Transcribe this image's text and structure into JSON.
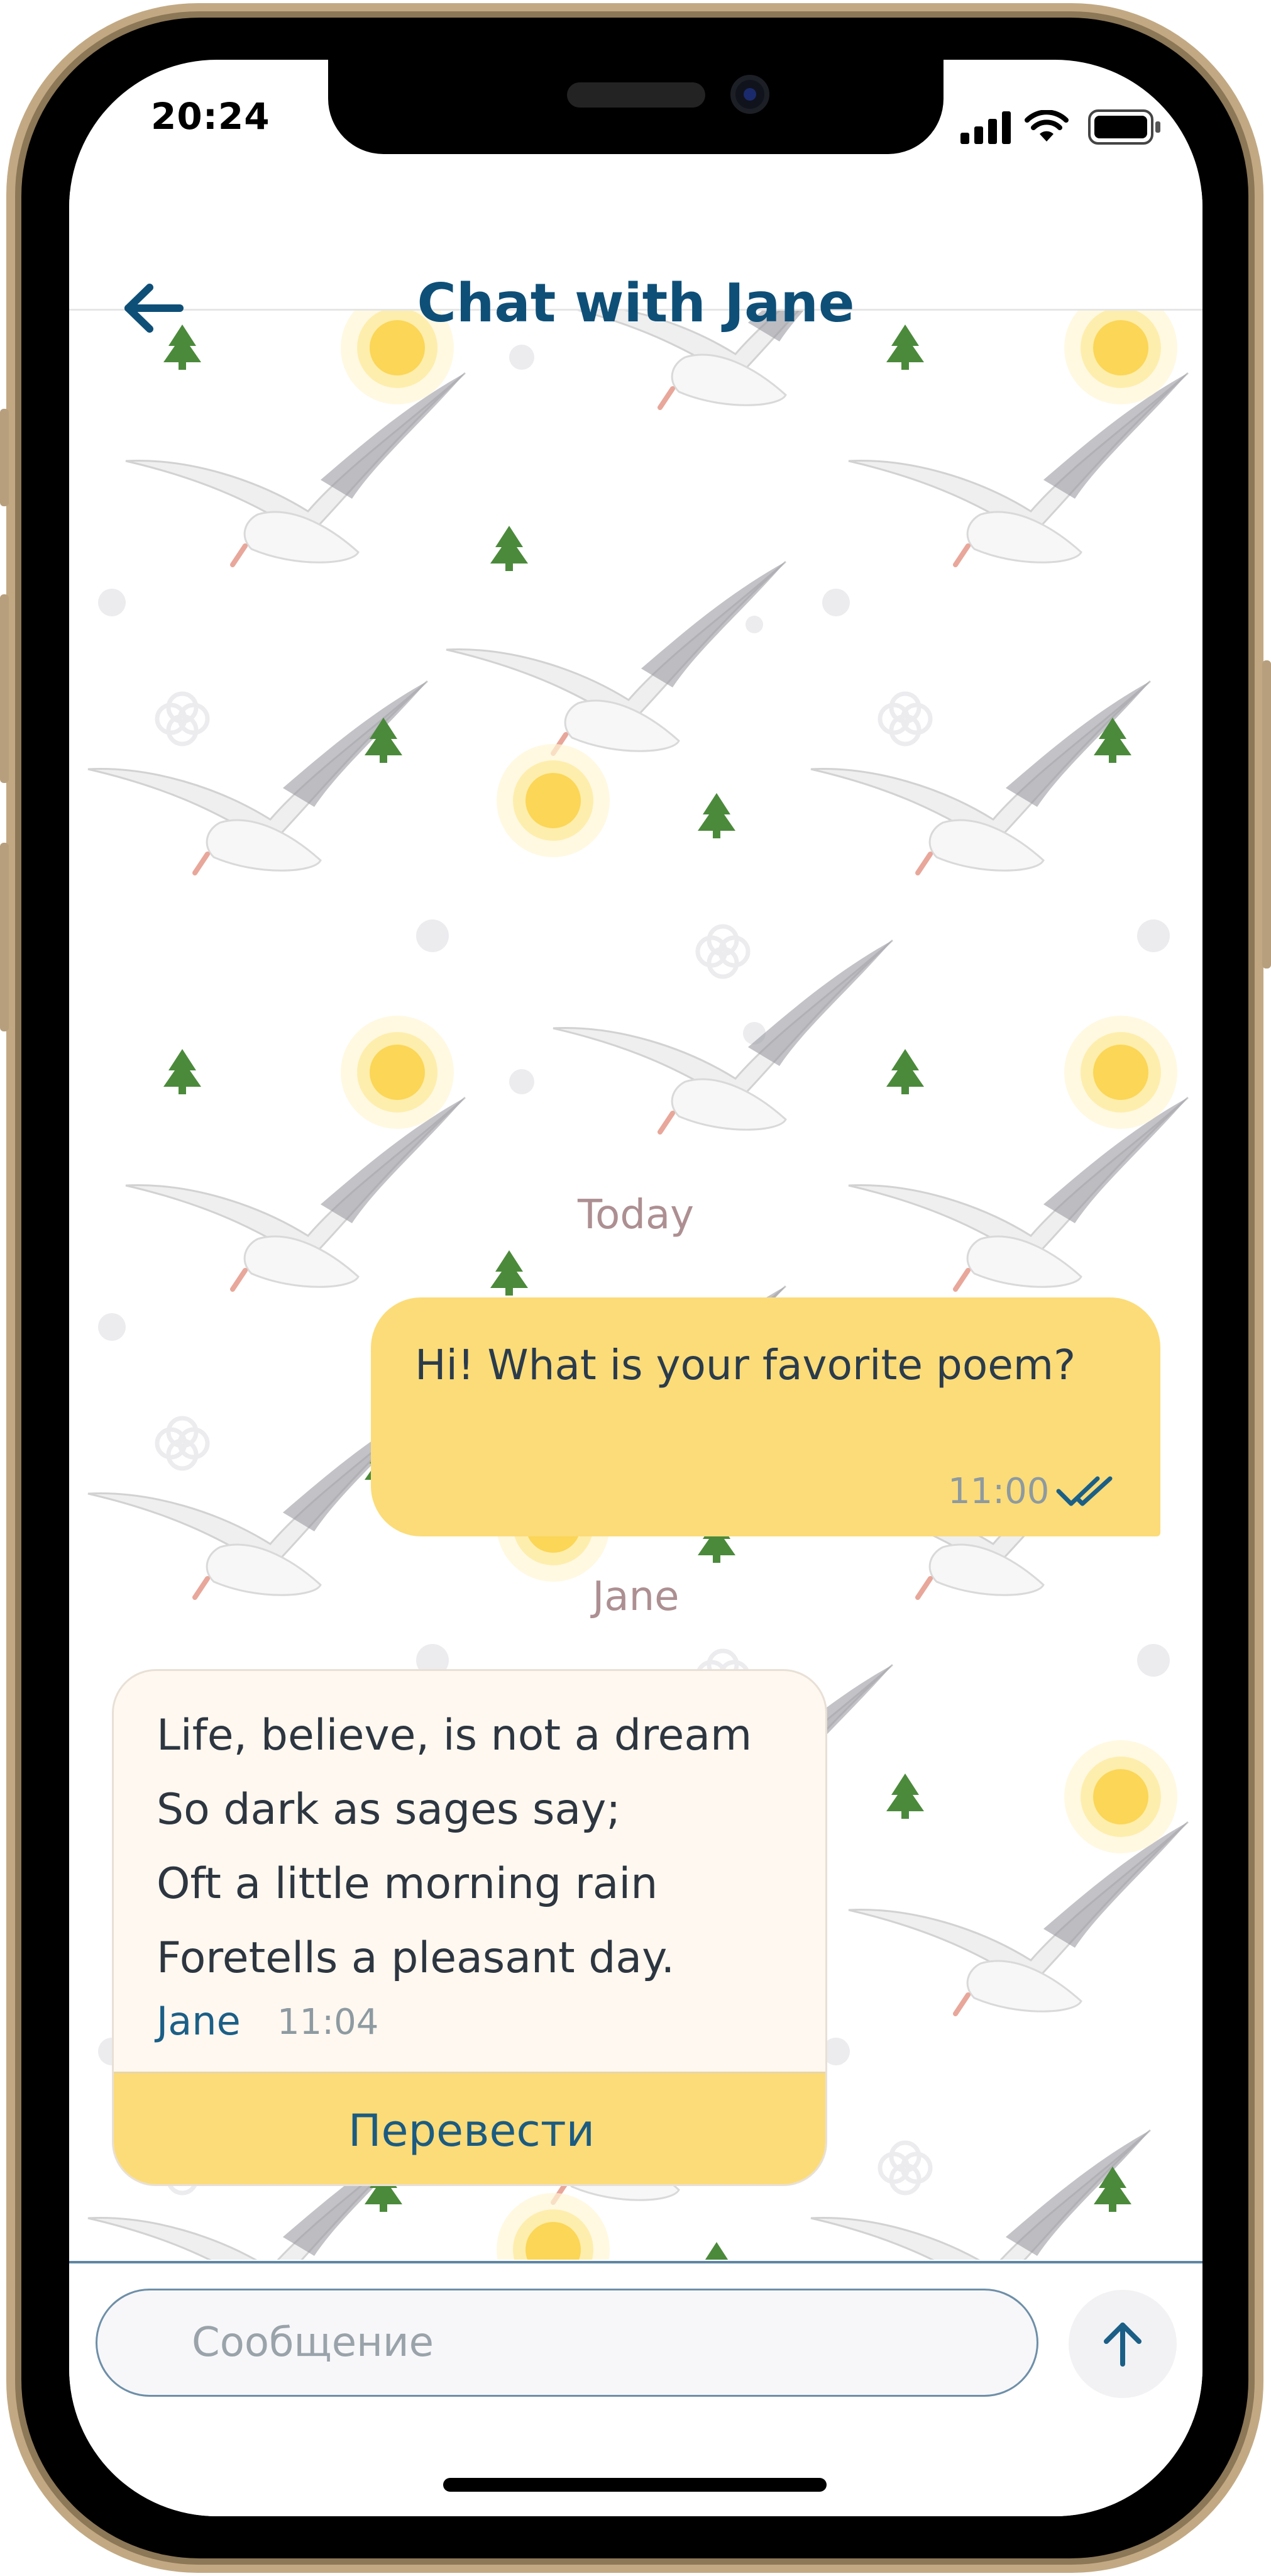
{
  "status_bar": {
    "time": "20:24"
  },
  "header": {
    "title": "Chat with Jane"
  },
  "chat": {
    "day_separator": "Today",
    "outgoing": {
      "text": "Hi! What is your favorite poem?",
      "time": "11:00"
    },
    "sender_label": "Jane",
    "incoming": {
      "lines": [
        "Life, believe, is not a dream",
        "So dark as sages say;",
        "Oft a little morning rain",
        "Foretells a pleasant day."
      ],
      "sender": "Jane",
      "time": "11:04",
      "translate_label": "Перевести"
    }
  },
  "composer": {
    "placeholder": "Сообщение"
  },
  "colors": {
    "accent": "#0e4f78",
    "bubble_yellow": "#fcdc78",
    "bubble_incoming": "#fff8f0",
    "frame_gold": "#b79f7d"
  },
  "icons": [
    "back-arrow-icon",
    "signal-icon",
    "wifi-icon",
    "battery-icon",
    "double-check-icon",
    "send-arrow-icon"
  ]
}
